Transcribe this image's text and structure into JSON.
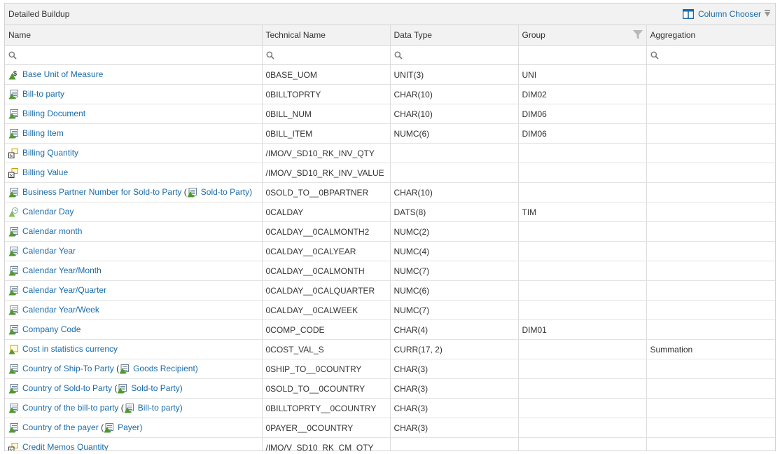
{
  "panel": {
    "title": "Detailed Buildup",
    "column_chooser_label": "Column Chooser"
  },
  "columns": [
    "Name",
    "Technical Name",
    "Data Type",
    "Group",
    "Aggregation"
  ],
  "rows": [
    {
      "icon": "unit",
      "name": "Base Unit of Measure",
      "ref": "",
      "tech": "0BASE_UOM",
      "type": "UNIT(3)",
      "group": "UNI",
      "agg": ""
    },
    {
      "icon": "char",
      "name": "Bill-to party",
      "ref": "",
      "tech": "0BILLTOPRTY",
      "type": "CHAR(10)",
      "group": "DIM02",
      "agg": ""
    },
    {
      "icon": "char",
      "name": "Billing Document",
      "ref": "",
      "tech": "0BILL_NUM",
      "type": "CHAR(10)",
      "group": "DIM06",
      "agg": ""
    },
    {
      "icon": "char",
      "name": "Billing Item",
      "ref": "",
      "tech": "0BILL_ITEM",
      "type": "NUMC(6)",
      "group": "DIM06",
      "agg": ""
    },
    {
      "icon": "calc",
      "name": "Billing Quantity",
      "ref": "",
      "tech": "/IMO/V_SD10_RK_INV_QTY",
      "type": "",
      "group": "",
      "agg": ""
    },
    {
      "icon": "calc",
      "name": "Billing Value",
      "ref": "",
      "tech": "/IMO/V_SD10_RK_INV_VALUE",
      "type": "",
      "group": "",
      "agg": ""
    },
    {
      "icon": "char",
      "name": "Business Partner Number for Sold-to Party",
      "ref": "Sold-to Party",
      "tech": "0SOLD_TO__0BPARTNER",
      "type": "CHAR(10)",
      "group": "",
      "agg": ""
    },
    {
      "icon": "time",
      "name": "Calendar Day",
      "ref": "",
      "tech": "0CALDAY",
      "type": "DATS(8)",
      "group": "TIM",
      "agg": ""
    },
    {
      "icon": "char",
      "name": "Calendar month",
      "ref": "",
      "tech": "0CALDAY__0CALMONTH2",
      "type": "NUMC(2)",
      "group": "",
      "agg": ""
    },
    {
      "icon": "char",
      "name": "Calendar Year",
      "ref": "",
      "tech": "0CALDAY__0CALYEAR",
      "type": "NUMC(4)",
      "group": "",
      "agg": ""
    },
    {
      "icon": "char",
      "name": "Calendar Year/Month",
      "ref": "",
      "tech": "0CALDAY__0CALMONTH",
      "type": "NUMC(7)",
      "group": "",
      "agg": ""
    },
    {
      "icon": "char",
      "name": "Calendar Year/Quarter",
      "ref": "",
      "tech": "0CALDAY__0CALQUARTER",
      "type": "NUMC(6)",
      "group": "",
      "agg": ""
    },
    {
      "icon": "char",
      "name": "Calendar Year/Week",
      "ref": "",
      "tech": "0CALDAY__0CALWEEK",
      "type": "NUMC(7)",
      "group": "",
      "agg": ""
    },
    {
      "icon": "char",
      "name": "Company Code",
      "ref": "",
      "tech": "0COMP_CODE",
      "type": "CHAR(4)",
      "group": "DIM01",
      "agg": ""
    },
    {
      "icon": "keyfig",
      "name": "Cost in statistics currency",
      "ref": "",
      "tech": "0COST_VAL_S",
      "type": "CURR(17, 2)",
      "group": "",
      "agg": "Summation"
    },
    {
      "icon": "char",
      "name": "Country of Ship-To Party",
      "ref": "Goods Recipient",
      "tech": "0SHIP_TO__0COUNTRY",
      "type": "CHAR(3)",
      "group": "",
      "agg": ""
    },
    {
      "icon": "char",
      "name": "Country of Sold-to Party",
      "ref": "Sold-to Party",
      "tech": "0SOLD_TO__0COUNTRY",
      "type": "CHAR(3)",
      "group": "",
      "agg": ""
    },
    {
      "icon": "char",
      "name": "Country of the bill-to party",
      "ref": "Bill-to party",
      "tech": "0BILLTOPRTY__0COUNTRY",
      "type": "CHAR(3)",
      "group": "",
      "agg": ""
    },
    {
      "icon": "char",
      "name": "Country of the payer",
      "ref": "Payer",
      "tech": "0PAYER__0COUNTRY",
      "type": "CHAR(3)",
      "group": "",
      "agg": ""
    },
    {
      "icon": "calc",
      "name": "Credit Memos Quantity",
      "ref": "",
      "tech": "/IMO/V_SD10_RK_CM_QTY",
      "type": "",
      "group": "",
      "agg": ""
    }
  ],
  "colors": {
    "link": "#1b6ba8",
    "header_bg": "#f2f2f2",
    "border": "#d4d4d4"
  }
}
